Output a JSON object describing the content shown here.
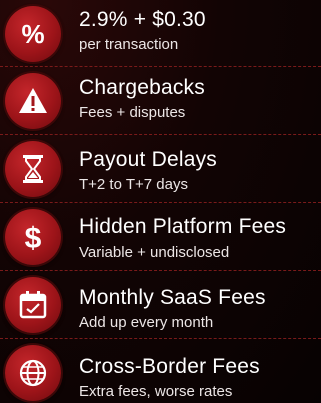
{
  "fees": [
    {
      "icon": "percent-icon",
      "title": "2.9% + $0.30",
      "subtitle": "per transaction"
    },
    {
      "icon": "warning-icon",
      "title": "Chargebacks",
      "subtitle": "Fees + disputes"
    },
    {
      "icon": "hourglass-icon",
      "title": "Payout Delays",
      "subtitle": "T+2 to T+7 days"
    },
    {
      "icon": "dollar-icon",
      "title": "Hidden Platform Fees",
      "subtitle": "Variable + undisclosed"
    },
    {
      "icon": "calendar-icon",
      "title": "Monthly SaaS Fees",
      "subtitle": "Add up every month"
    },
    {
      "icon": "globe-icon",
      "title": "Cross-Border Fees",
      "subtitle": "Extra fees, worse rates"
    }
  ],
  "colors": {
    "badge": "#b01c21",
    "background": "#0b0303",
    "divider": "#7a1a1a"
  }
}
